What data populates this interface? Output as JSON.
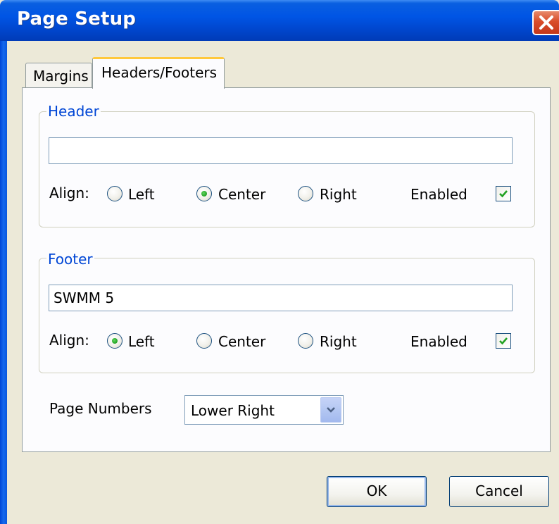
{
  "window": {
    "title": "Page Setup"
  },
  "tabs": [
    {
      "label": "Margins"
    },
    {
      "label": "Headers/Footers"
    }
  ],
  "header": {
    "legend": "Header",
    "text_value": "",
    "align_label": "Align:",
    "options": [
      "Left",
      "Center",
      "Right"
    ],
    "selected": "Center",
    "enabled_label": "Enabled",
    "enabled": true
  },
  "footer": {
    "legend": "Footer",
    "text_value": "SWMM 5",
    "align_label": "Align:",
    "options": [
      "Left",
      "Center",
      "Right"
    ],
    "selected": "Left",
    "enabled_label": "Enabled",
    "enabled": true
  },
  "page_numbers": {
    "label": "Page Numbers",
    "selected_value": "Lower Right"
  },
  "buttons": {
    "ok": "OK",
    "cancel": "Cancel"
  },
  "colors": {
    "titlebar": "#0055e5",
    "group_legend": "#0046d5",
    "active_tab_accent": "#ffc83c",
    "radio_dot": "#21a121",
    "checkmark": "#21a121"
  }
}
